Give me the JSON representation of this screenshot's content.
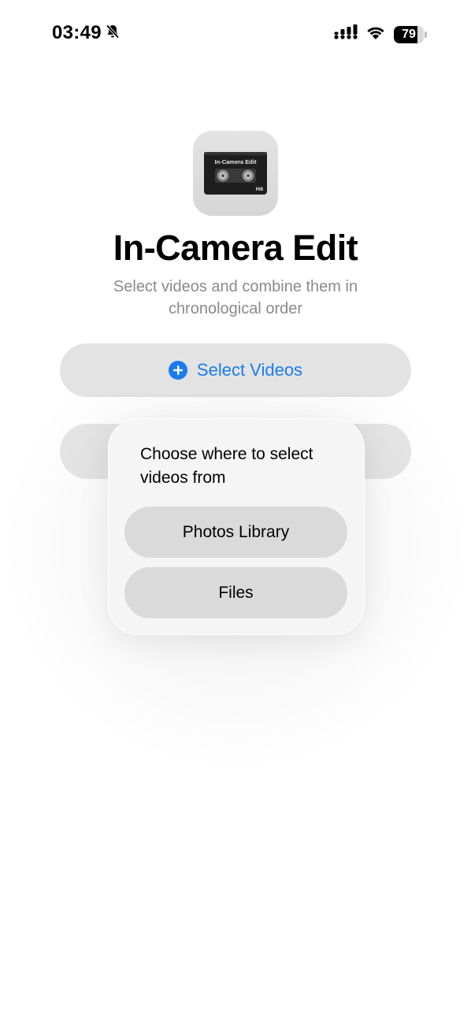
{
  "status_bar": {
    "time": "03:49",
    "battery_level": "79",
    "battery_fraction": 0.79,
    "icons": [
      "bell-slash-icon",
      "cellular-signal-icon",
      "wifi-icon",
      "battery-icon"
    ]
  },
  "app": {
    "icon_label": "In-Camera Edit",
    "icon_badge": "Hi8",
    "title": "In-Camera Edit",
    "subtitle": "Select videos and combine them in chronological order"
  },
  "main": {
    "select_videos_label": "Select Videos",
    "accent_color": "#1a7cf0"
  },
  "popup": {
    "title": "Choose where to select videos from",
    "options": [
      {
        "label": "Photos Library"
      },
      {
        "label": "Files"
      }
    ]
  }
}
